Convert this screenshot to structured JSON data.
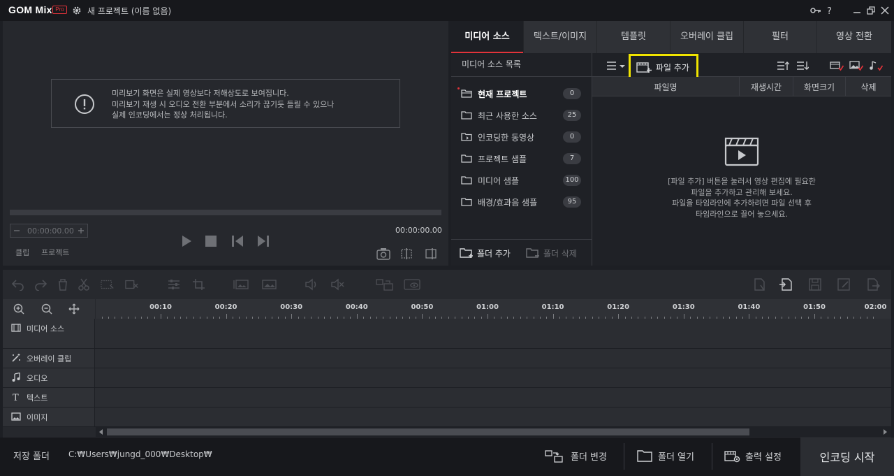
{
  "app": {
    "logo": "GOM Mix",
    "badge": "Pro",
    "project_title": "새 프로젝트 (이름 없음)"
  },
  "preview": {
    "notice_lines": [
      "미리보기 화면은 실제 영상보다 저해상도로 보여집니다.",
      "미리보기 재생 시 오디오 전환 부분에서 소리가 끊기듯 들릴 수 있으나",
      "실제 인코딩에서는 정상 처리됩니다."
    ],
    "time_input": "00:00:00.00",
    "current_time": "00:00:00.00",
    "clip_label": "클립",
    "project_label": "프로젝트"
  },
  "tabs": [
    {
      "label": "미디어 소스",
      "active": true
    },
    {
      "label": "텍스트/이미지"
    },
    {
      "label": "템플릿"
    },
    {
      "label": "오버레이 클립"
    },
    {
      "label": "필터"
    },
    {
      "label": "영상 전환"
    }
  ],
  "source_list": {
    "title": "미디어 소스 목록",
    "items": [
      {
        "label": "현재 프로젝트",
        "count": "0"
      },
      {
        "label": "최근 사용한 소스",
        "count": "25"
      },
      {
        "label": "인코딩한 동영상",
        "count": "0"
      },
      {
        "label": "프로젝트 샘플",
        "count": "7"
      },
      {
        "label": "미디어 샘플",
        "count": "100"
      },
      {
        "label": "배경/효과음 샘플",
        "count": "95"
      }
    ],
    "add_folder": "폴더 추가",
    "delete_folder": "폴더 삭제"
  },
  "file_area": {
    "add_file": "파일 추가",
    "columns": [
      "파일명",
      "재생시간",
      "화면크기",
      "삭제"
    ],
    "empty_lines": [
      "[파일 추가] 버튼을 눌러서 영상 편집에 필요한",
      "파일을 추가하고 관리해 보세요.",
      "파일을 타임라인에 추가하려면 파일 선택 후",
      "타임라인으로 끌어 놓으세요."
    ]
  },
  "timeline": {
    "ruler": [
      "00:10",
      "00:20",
      "00:30",
      "00:40",
      "00:50",
      "01:00",
      "01:10",
      "01:20",
      "01:30",
      "01:40",
      "01:50",
      "02:00"
    ],
    "tracks": [
      {
        "label": "미디어 소스",
        "icon": "film-icon"
      },
      {
        "label": "오버레이 클립",
        "icon": "magic-wand-icon"
      },
      {
        "label": "오디오",
        "icon": "music-note-icon"
      },
      {
        "label": "텍스트",
        "icon": "text-icon"
      },
      {
        "label": "이미지",
        "icon": "image-icon"
      }
    ]
  },
  "bottom": {
    "save_folder_label": "저장 폴더",
    "save_path": "C:₩Users₩jungd_000₩Desktop₩",
    "change_folder": "폴더 변경",
    "open_folder": "폴더 열기",
    "output_settings": "출력 설정",
    "start_encoding": "인코딩 시작"
  },
  "colors": {
    "accent_red": "#e2333a",
    "highlight_yellow": "#f0e400"
  }
}
